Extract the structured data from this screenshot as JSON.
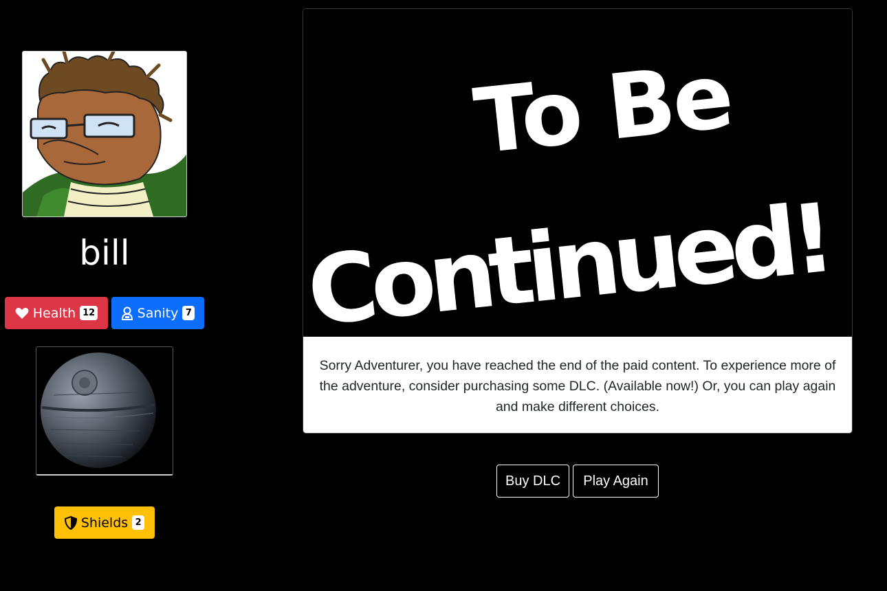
{
  "player": {
    "name": "bill",
    "avatar_icon": "character-portrait-icon"
  },
  "stats": {
    "health": {
      "label": "Health",
      "value": "12",
      "icon": "heart-icon",
      "color": "#dc3545"
    },
    "sanity": {
      "label": "Sanity",
      "value": "7",
      "icon": "person-badge-icon",
      "color": "#0d6efd"
    }
  },
  "inventory": {
    "item_icon": "space-station-icon",
    "shields": {
      "label": "Shields",
      "value": "2",
      "icon": "shield-icon",
      "color": "#ffc107"
    }
  },
  "story": {
    "image_text": [
      "To Be",
      "Continued!"
    ],
    "message": "Sorry Adventurer, you have reached the end of the paid content. To experience more of the adventure, consider purchasing some DLC. (Available now!) Or, you can play again and make different choices."
  },
  "actions": {
    "buy_label": "Buy DLC",
    "play_again_label": "Play Again"
  }
}
